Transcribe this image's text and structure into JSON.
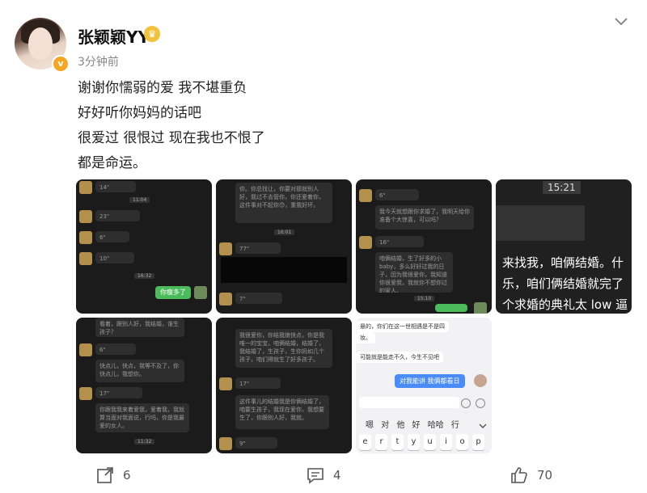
{
  "post": {
    "username": "张颖颖YY",
    "time": "3分钟前",
    "lines": [
      "谢谢你懦弱的爱 我不堪重负",
      "好好听你妈妈的话吧",
      "很爱过 很恨过 现在我也不恨了",
      "都是命运。"
    ]
  },
  "badges": {
    "verified": "v",
    "crown": "♛"
  },
  "thumbs": {
    "t1": {
      "time": "11:04",
      "v1": "14\"",
      "v2": "23\"",
      "v3": "6\"",
      "v4": "10\"",
      "green": "你瘦多了",
      "time2": "16:32"
    },
    "t2": {
      "text1": "你。你总找让，你要对那就别人好，我过不去管你，你还爱着你，这件事对不起你😊，重我好坏。",
      "time": "16:01",
      "v1": "77\"",
      "v2": "7\""
    },
    "t3": {
      "v1": "6\"",
      "text1": "我今天就想跟你求婚了，我明天给你准备个大惊喜，可以吗？",
      "v2": "16\"",
      "text2": "咱俩结婚，生了好多的小baby，多么好好过我的日子，因为我很爱你，我知道你很爱我，我就你不想你过的家人。",
      "time": "15:10"
    },
    "t4": {
      "time": "15:21",
      "l1": "来找我，咱俩结婚。什",
      "l2": "乐，咱们俩结婚就完了",
      "l3": "个求婚的典礼太 low 逼"
    },
    "t5": {
      "top": "看着，跟别人好，我结婚，谁生孩子？",
      "v1": "6\"",
      "text1": "快点儿，快点，我等不及了，你快点儿，我想你。",
      "v2": "17\"",
      "text2": "你跟我我来着爱我，爱着我，我就算当面对我面说，行吗，你是我最爱的女人。",
      "time": "11:32"
    },
    "t6": {
      "text1": "我很爱你，你结我娘快点，你是我唯一的宝宝，咱俩结婚，结婚了，我结婚了，生孩子，生你妈如几个孩子，咱们得就生了好多孩子。",
      "v1": "17\"",
      "text2": "这件事儿的结婚我是你俩结婚了，咱要生孩子，我现在爱你，我想要生了，你跟别人好，我就。",
      "v2": "9\""
    },
    "t7": {
      "l1": "悬的，你们在这一世相遇是不是四",
      "l2": "妆。",
      "l3": "可能就是能走不久，今生不见吧",
      "blue": "对我能讲 我俩都看日",
      "cand": "嗯 对 他 好 哈哈 行",
      "keys": [
        "e",
        "r",
        "t",
        "y",
        "u",
        "i",
        "o",
        "p"
      ]
    }
  },
  "actions": {
    "share": "6",
    "comment": "4",
    "like": "70"
  },
  "colors": {
    "green": "#4cbb5c",
    "blue": "#4a8cf7",
    "gold": "#f5a623"
  }
}
